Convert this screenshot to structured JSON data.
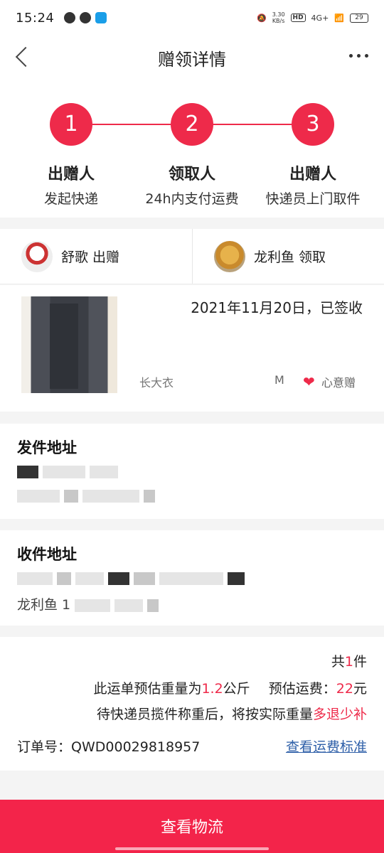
{
  "status": {
    "time": "15:24",
    "speed_value": "3.30",
    "speed_unit": "KB/s",
    "hd": "HD",
    "network": "4G+",
    "battery": "29"
  },
  "nav": {
    "title": "赠领详情"
  },
  "steps": [
    {
      "number": "1",
      "title": "出赠人",
      "sub": "发起快递"
    },
    {
      "number": "2",
      "title": "领取人",
      "sub": "24h内支付运费"
    },
    {
      "number": "3",
      "title": "出赠人",
      "sub": "快递员上门取件"
    }
  ],
  "users": {
    "giver": "舒歌 出赠",
    "receiver": "龙利鱼 领取"
  },
  "item": {
    "date": "2021年11月20日，已签收",
    "name": "长大衣",
    "size": "M",
    "tag": "心意赠"
  },
  "send_address": {
    "title": "发件地址"
  },
  "receive_address": {
    "title": "收件地址",
    "name_prefix": "龙利鱼 1"
  },
  "summary": {
    "count_prefix": "共",
    "count": "1",
    "count_suffix": "件",
    "weight_prefix": "此运单预估重量为",
    "weight": "1.2",
    "weight_unit": "公斤",
    "fee_label": "预估运费：",
    "fee": "22",
    "fee_unit": "元",
    "note_prefix": "待快递员揽件称重后，将按实际重量",
    "note_red": "多退少补",
    "order_label": "订单号：",
    "order_number": "QWD00029818957",
    "fee_standard_link": "查看运费标准"
  },
  "bottom": {
    "button": "查看物流"
  }
}
